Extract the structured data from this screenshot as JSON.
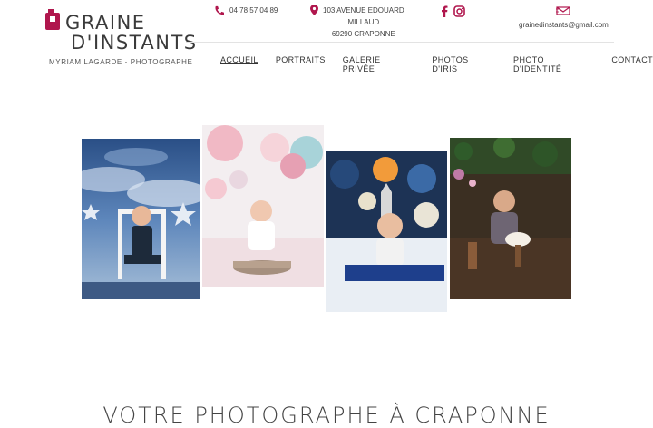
{
  "brand": {
    "line1": "GRAINE",
    "line2": "D'INSTANTS",
    "tagline": "MYRIAM LAGARDE - PHOTOGRAPHE",
    "accent_color": "#b0164d"
  },
  "contact": {
    "phone_icon": "phone-icon",
    "phone": "04 78 57 04 89",
    "address_icon": "map-pin-icon",
    "address_line1": "103 AVENUE EDOUARD",
    "address_line2": "MILLAUD",
    "address_line3": "69290 CRAPONNE",
    "email_icon": "envelope-icon",
    "email": "grainedinstants@gmail.com",
    "social": [
      "facebook-icon",
      "instagram-icon"
    ]
  },
  "nav": {
    "items": [
      {
        "label": "ACCUEIL",
        "active": true
      },
      {
        "label": "PORTRAITS"
      },
      {
        "label": "GALERIE PRIVÉE"
      },
      {
        "label": "PHOTOS D'IRIS"
      },
      {
        "label": "PHOTO D'IDENTITÉ"
      },
      {
        "label": "CONTACT"
      }
    ]
  },
  "gallery": {
    "photos": [
      {
        "subject": "baby on white chair, blue cloud backdrop"
      },
      {
        "subject": "baby in basket with pink balloons"
      },
      {
        "subject": "baby in space-themed setting"
      },
      {
        "subject": "toddler with cake smash, wooden decor"
      }
    ]
  },
  "hero": {
    "headline": "VOTRE PHOTOGRAPHE À CRAPONNE"
  }
}
